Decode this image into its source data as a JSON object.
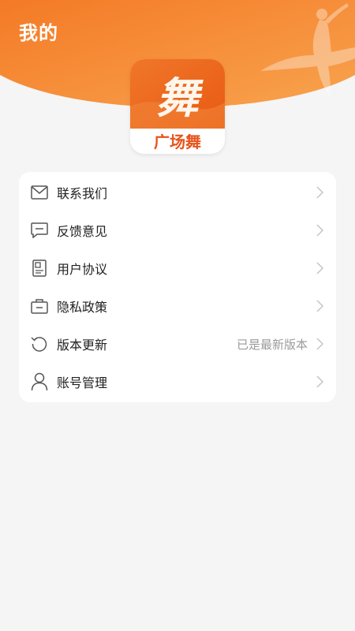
{
  "page": {
    "title": "我的"
  },
  "logo": {
    "brand_name": "广场舞",
    "glyph": "舞"
  },
  "menu": {
    "items": [
      {
        "label": "联系我们",
        "icon": "mail-icon",
        "value": ""
      },
      {
        "label": "反馈意见",
        "icon": "feedback-icon",
        "value": ""
      },
      {
        "label": "用户协议",
        "icon": "document-icon",
        "value": ""
      },
      {
        "label": "隐私政策",
        "icon": "briefcase-icon",
        "value": ""
      },
      {
        "label": "版本更新",
        "icon": "refresh-icon",
        "value": "已是最新版本"
      },
      {
        "label": "账号管理",
        "icon": "user-icon",
        "value": ""
      }
    ]
  },
  "colors": {
    "header_orange": "#f47f2a",
    "header_orange_light": "#f8a04a",
    "logo_orange": "#ef6b1e",
    "text_primary": "#222222",
    "text_secondary": "#9a9a9a",
    "icon_gray": "#555555",
    "background": "#f5f5f5"
  }
}
